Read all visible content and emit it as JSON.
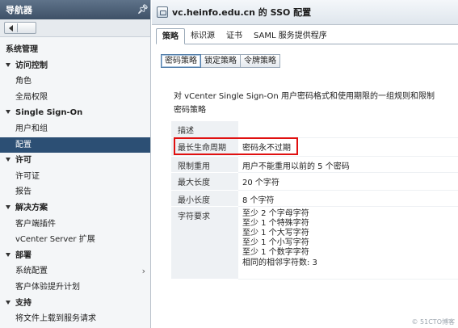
{
  "navigator": {
    "title": "导航器",
    "items": [
      {
        "label": "系统管理",
        "kind": "root"
      },
      {
        "label": "访问控制",
        "kind": "section"
      },
      {
        "label": "角色",
        "kind": "item"
      },
      {
        "label": "全局权限",
        "kind": "item"
      },
      {
        "label": "Single Sign-On",
        "kind": "section"
      },
      {
        "label": "用户和组",
        "kind": "item"
      },
      {
        "label": "配置",
        "kind": "item",
        "selected": true
      },
      {
        "label": "许可",
        "kind": "section"
      },
      {
        "label": "许可证",
        "kind": "item"
      },
      {
        "label": "报告",
        "kind": "item"
      },
      {
        "label": "解决方案",
        "kind": "section"
      },
      {
        "label": "客户端插件",
        "kind": "item"
      },
      {
        "label": "vCenter Server 扩展",
        "kind": "item"
      },
      {
        "label": "部署",
        "kind": "section"
      },
      {
        "label": "系统配置",
        "kind": "item",
        "has_chevron": true
      },
      {
        "label": "客户体验提升计划",
        "kind": "item"
      },
      {
        "label": "支持",
        "kind": "section"
      },
      {
        "label": "将文件上载到服务请求",
        "kind": "item"
      }
    ]
  },
  "main": {
    "title": "vc.heinfo.edu.cn 的 SSO 配置",
    "tabs": [
      {
        "label": "策略",
        "active": true
      },
      {
        "label": "标识源"
      },
      {
        "label": "证书"
      },
      {
        "label": "SAML 服务提供程序"
      }
    ],
    "subtabs": [
      {
        "label": "密码策略",
        "active": true
      },
      {
        "label": "锁定策略"
      },
      {
        "label": "令牌策略"
      }
    ],
    "description": "对 vCenter Single Sign-On 用户密码格式和使用期限的一组规则和限制",
    "section_title": "密码策略",
    "policy": {
      "desc_label": "描述",
      "desc_value": "",
      "max_lifetime_label": "最长生命周期",
      "max_lifetime_value": "密码永不过期",
      "reuse_label": "限制重用",
      "reuse_value": "用户不能重用以前的 5 个密码",
      "max_length_label": "最大长度",
      "max_length_value": "20 个字符",
      "min_length_label": "最小长度",
      "min_length_value": "8 个字符",
      "char_req_label": "字符要求",
      "char_req_lines": [
        "至少 2 个字母字符",
        "至少 1 个特殊字符",
        "至少 1 个大写字符",
        "至少 1 个小写字符",
        "至少 1 个数字字符",
        "相同的相邻字符数: 3"
      ]
    }
  },
  "highlight_color": "#e01010",
  "watermark": "© 51CTO博客"
}
